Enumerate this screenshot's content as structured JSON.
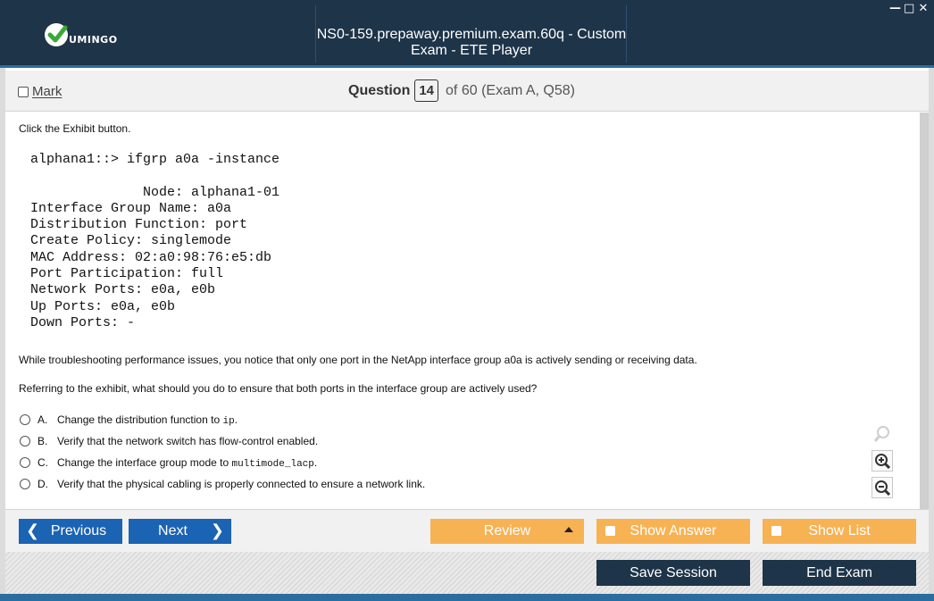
{
  "window": {
    "title": "NS0-159.prepaway.premium.exam.60q - Custom Exam - ETE Player",
    "logo_text": "UMINGO",
    "controls": [
      "minimize-icon",
      "maximize-icon",
      "close-icon"
    ]
  },
  "header": {
    "mark_label": "Mark",
    "question_label": "Question",
    "question_number": "14",
    "question_of": "of 60 (Exam A, Q58)"
  },
  "question": {
    "intro": "Click the Exhibit button.",
    "exhibit": "alphana1::> ifgrp a0a -instance\n\n              Node: alphana1-01\nInterface Group Name: a0a\nDistribution Function: port\nCreate Policy: singlemode\nMAC Address: 02:a0:98:76:e5:db\nPort Participation: full\nNetwork Ports: e0a, e0b\nUp Ports: e0a, e0b\nDown Ports: -",
    "paragraph1": "While troubleshooting performance issues, you notice that only one port in the NetApp interface group a0a is actively sending or receiving data.",
    "paragraph2": "Referring to the exhibit, what should you do to ensure that both ports in the interface group are actively used?",
    "answers": [
      {
        "letter": "A.",
        "text": "Change the distribution function to ",
        "code": "ip",
        "suffix": "."
      },
      {
        "letter": "B.",
        "text": "Verify that the network switch has flow-control enabled.",
        "code": "",
        "suffix": ""
      },
      {
        "letter": "C.",
        "text": "Change the interface group mode to ",
        "code": "multimode_lacp",
        "suffix": "."
      },
      {
        "letter": "D.",
        "text": "Verify that the physical cabling is properly connected to ensure a network link.",
        "code": "",
        "suffix": ""
      }
    ]
  },
  "zoom": [
    "magnifier-icon",
    "zoom-in-icon",
    "zoom-out-icon"
  ],
  "nav": {
    "previous": "Previous",
    "next": "Next",
    "review": "Review",
    "show_answer": "Show Answer",
    "show_list": "Show List"
  },
  "footer": {
    "save_session": "Save Session",
    "end_exam": "End Exam"
  },
  "colors": {
    "titlebar": "#1e3448",
    "accent_blue": "#1b63b3",
    "accent_orange": "#f7b254",
    "logo_green": "#3aa935"
  }
}
